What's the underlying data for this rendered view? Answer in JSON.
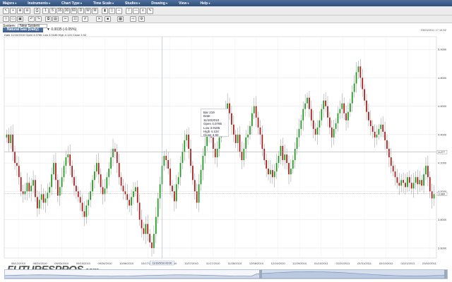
{
  "menubar": {
    "items": [
      "Majors",
      "Instruments",
      "Chart Type",
      "Time Scale",
      "Studies",
      "Drawing",
      "View",
      "Help"
    ]
  },
  "system_bar": {
    "label": "System:",
    "value": "New System"
  },
  "chart_header": {
    "symbol": "Natural Gas (Daily)",
    "change": "▼ 0.0035 (-0.05%)",
    "timestamp": "03/03/2011 17:14:52",
    "ohlc": "Date 11/10/2010 Open 4.0785 Low 3.9185 High 4.124 Close 3.92"
  },
  "tooltip": {
    "bar": "Bar 219",
    "date": "Date 11/10/2010",
    "open": "Open 4.0785",
    "low": "Low 3.9185",
    "high": "High 4.124",
    "close": "Close 3.92"
  },
  "crosshair_label": "11/10/2010 00:00",
  "watermark": {
    "main": "FUTURESPROS",
    "suffix": ".com"
  },
  "colors": {
    "up": "#1a9b1a",
    "down": "#b01818",
    "menubar": "#3e5f8c",
    "grid": "#e2e2e2"
  },
  "chart_data": {
    "type": "candlestick",
    "xlabel": "",
    "ylabel": "",
    "x_ticks": [
      "08/12/2010",
      "08/24/2010",
      "09/03/2010",
      "09/15/2010",
      "09/26/2010",
      "10/06/2010",
      "10/17/2010",
      "10/27/2010",
      "11/07/2010",
      "11/17/2010",
      "11/28/2010",
      "12/08/2010",
      "12/19/2010",
      "12/29/2010",
      "01/10/2011",
      "01/20/2011",
      "01/31/2011",
      "02/10/2011",
      "02/21/2011",
      "03/02/2011"
    ],
    "y_ticks": [
      3.6,
      3.8,
      4.0,
      4.2,
      4.4,
      4.6,
      4.8,
      5.0
    ],
    "y_labels": [
      "3.6000",
      "3.8000",
      "4.0000",
      "4.2000",
      "4.4000",
      "4.6000",
      "4.8000",
      "5.0000"
    ],
    "ylim": [
      3.53,
      5.09
    ],
    "price_labels": [
      4.277,
      3.983
    ],
    "price_label_text": [
      "4.277",
      "3.983"
    ],
    "grid": true,
    "closes": [
      4.4,
      4.34,
      4.4,
      4.28,
      4.2,
      4.18,
      4.1,
      4.0,
      3.98,
      4.0,
      4.06,
      4.0,
      4.04,
      4.08,
      3.96,
      3.88,
      3.94,
      3.98,
      3.92,
      3.95,
      3.99,
      4.03,
      4.12,
      4.2,
      4.08,
      3.97,
      4.03,
      4.1,
      4.18,
      4.24,
      4.26,
      4.18,
      4.1,
      4.04,
      4.0,
      3.96,
      3.92,
      3.86,
      3.82,
      3.9,
      3.94,
      4.0,
      4.08,
      4.14,
      4.2,
      4.12,
      4.03,
      3.98,
      4.02,
      4.1,
      4.16,
      4.24,
      4.3,
      4.28,
      4.2,
      4.1,
      4.04,
      4.0,
      3.98,
      3.94,
      3.9,
      3.96,
      4.0,
      4.03,
      3.92,
      3.8,
      3.74,
      3.7,
      3.77,
      3.7,
      3.64,
      3.6,
      3.7,
      3.82,
      3.95,
      4.05,
      4.18,
      4.25,
      4.22,
      4.16,
      4.04,
      4.0,
      3.93,
      4.05,
      4.1,
      4.2,
      4.28,
      4.36,
      4.4,
      4.3,
      4.18,
      4.08,
      4.0,
      3.92,
      4.05,
      4.15,
      4.25,
      4.32,
      4.4,
      4.45,
      4.38,
      4.3,
      4.24,
      4.3,
      4.38,
      4.44,
      4.5,
      4.58,
      4.62,
      4.55,
      4.47,
      4.4,
      4.34,
      4.4,
      4.28,
      4.22,
      4.3,
      4.38,
      4.4,
      4.46,
      4.55,
      4.6,
      4.52,
      4.45,
      4.4,
      4.3,
      4.22,
      4.16,
      4.12,
      4.15,
      4.1,
      4.14,
      4.2,
      4.25,
      4.32,
      4.22,
      4.26,
      4.2,
      4.12,
      4.16,
      4.22,
      4.3,
      4.38,
      4.44,
      4.5,
      4.58,
      4.62,
      4.66,
      4.58,
      4.5,
      4.44,
      4.4,
      4.45,
      4.5,
      4.58,
      4.64,
      4.6,
      4.52,
      4.45,
      4.38,
      4.44,
      4.48,
      4.55,
      4.58,
      4.62,
      4.55,
      4.5,
      4.56,
      4.62,
      4.7,
      4.76,
      4.84,
      4.88,
      4.8,
      4.72,
      4.64,
      4.56,
      4.5,
      4.46,
      4.42,
      4.38,
      4.4,
      4.44,
      4.47,
      4.42,
      4.36,
      4.3,
      4.24,
      4.18,
      4.14,
      4.1,
      4.06,
      4.04,
      4.08,
      4.06,
      4.03,
      4.1,
      4.06,
      4.02,
      4.06,
      4.1,
      4.05,
      4.08,
      4.04,
      4.12,
      4.18,
      4.1,
      4.0,
      3.95,
      3.98
    ]
  }
}
